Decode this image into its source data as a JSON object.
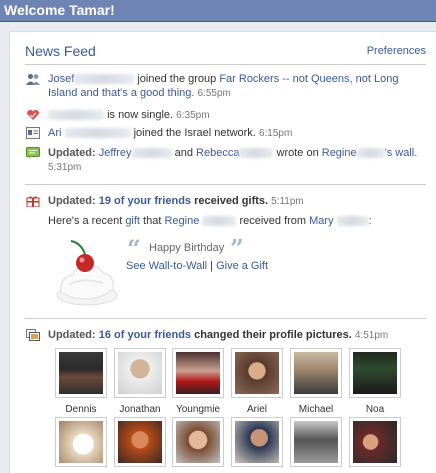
{
  "header": {
    "title": "Welcome Tamar!"
  },
  "feed": {
    "title": "News Feed",
    "preferences": "Preferences",
    "stories": [
      {
        "icon": "friends-icon",
        "actor": "Josef",
        "text1": " joined the group ",
        "link": "Far Rockers -- not Queens, not Long Island and that's a good thing.",
        "time": "6:55pm"
      },
      {
        "icon": "heart-icon",
        "text1": "is now single.",
        "time": "6:35pm"
      },
      {
        "icon": "network-icon",
        "actor": "Ari",
        "text1": " joined the Israel network.",
        "time": "6:15pm"
      },
      {
        "icon": "wall-icon",
        "updated": "Updated: ",
        "actor": "Jeffrey",
        "and": " and ",
        "actor2": "Rebecca",
        "wrote": " wrote on ",
        "actor3": "Regine",
        "possessive": "'s",
        "wall": "wall.",
        "time": "5:31pm"
      }
    ],
    "gifts": {
      "icon": "gift-icon",
      "updated": "Updated:",
      "count_text": "19 of your friends",
      "received": " received gifts.",
      "time": "5:11pm",
      "line_prefix": "Here's a recent ",
      "gift_word": "gift",
      "line_mid": " that ",
      "recipient": "Regine",
      "received_from": " received from ",
      "sender": "Mary",
      "colon": ":",
      "quote": "Happy Birthday",
      "link1": "See Wall-to-Wall",
      "divider": " | ",
      "link2": "Give a Gift"
    },
    "pictures": {
      "icon": "pictures-icon",
      "updated": "Updated:",
      "count_text": "16 of your friends",
      "changed": " changed their profile pictures.",
      "time": "4:51pm",
      "names": [
        "Dennis",
        "Jonathan",
        "Youngmie",
        "Ariel",
        "Michael",
        "Noa"
      ]
    }
  },
  "colors": {
    "accent": "#3b5998",
    "topbar": "#6d84b4"
  }
}
